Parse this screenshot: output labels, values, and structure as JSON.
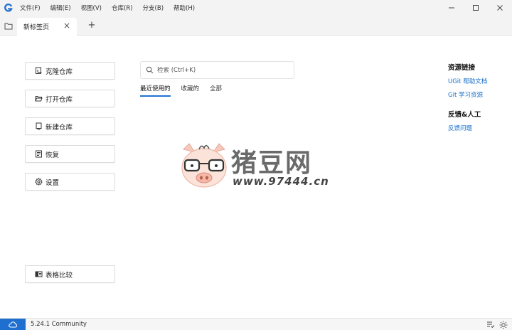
{
  "menu": [
    {
      "label": "文件(F)"
    },
    {
      "label": "编辑(E)"
    },
    {
      "label": "视图(V)"
    },
    {
      "label": "仓库(R)"
    },
    {
      "label": "分支(B)"
    },
    {
      "label": "帮助(H)"
    }
  ],
  "window_controls": {
    "minimize": "—",
    "maximize": "☐",
    "close": "✕"
  },
  "tabs": {
    "active_label": "新标签页",
    "close_glyph": "×",
    "new_tab_glyph": "+"
  },
  "actions": {
    "clone": "克隆仓库",
    "open": "打开仓库",
    "create": "新建仓库",
    "restore": "恢复",
    "settings": "设置",
    "table_compare": "表格比较"
  },
  "search": {
    "placeholder": "检索 (Ctrl+K)",
    "value": ""
  },
  "filters": [
    {
      "label": "最近使用的",
      "active": true
    },
    {
      "label": "收藏的",
      "active": false
    },
    {
      "label": "全部",
      "active": false
    }
  ],
  "resources": {
    "heading": "资源链接",
    "links": [
      {
        "label": "UGit 帮助文档"
      },
      {
        "label": "Git 学习资源"
      }
    ]
  },
  "feedback": {
    "heading": "反馈&人工",
    "links": [
      {
        "label": "反馈问题"
      }
    ]
  },
  "watermark": {
    "title": "猪豆网",
    "url": "www.97444.cn"
  },
  "status": {
    "version": "5.24.1 Community"
  },
  "colors": {
    "accent": "#1e6fcf",
    "link": "#1a6fc9",
    "titlebar": "#f3f3f3"
  },
  "icons": {
    "app": "ugit-logo-icon",
    "cloud": "cloud-icon",
    "theme": "sun-icon",
    "tasks": "list-check-icon"
  }
}
